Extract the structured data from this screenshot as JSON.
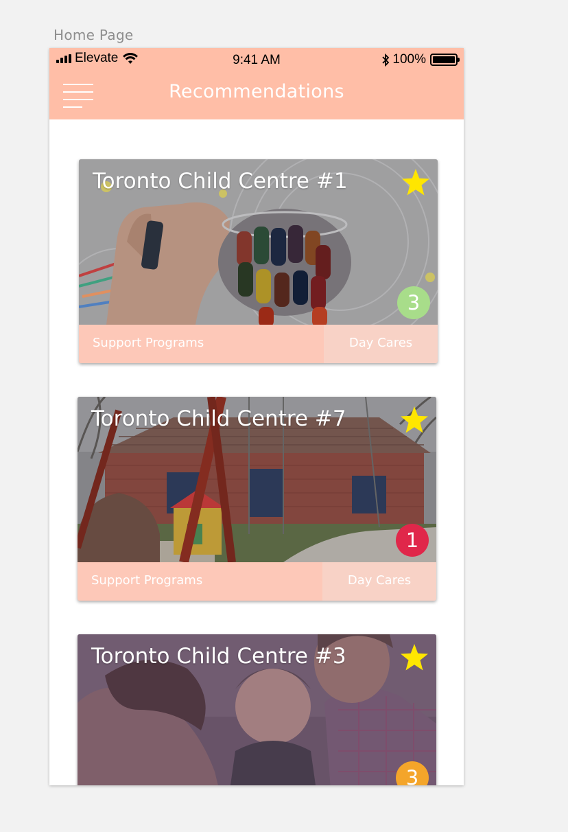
{
  "artboard_label": "Home Page",
  "status_bar": {
    "carrier": "Elevate",
    "time": "9:41 AM",
    "battery": "100%"
  },
  "nav": {
    "title": "Recommendations",
    "menu_icon": "hamburger-icon"
  },
  "colors": {
    "header": "#ffbea7",
    "tag_primary": "#fdc8b8",
    "tag_secondary": "#f8d2c6",
    "star": "#ffe600"
  },
  "cards": [
    {
      "title": "Toronto Child Centre #1",
      "icon": "star-icon",
      "badge": "3",
      "badge_color": "#a8dd8a",
      "tag_primary": "Support Programs",
      "tag_secondary": "Day Cares"
    },
    {
      "title": "Toronto Child Centre #7",
      "icon": "star-icon",
      "badge": "1",
      "badge_color": "#e0274a",
      "tag_primary": "Support Programs",
      "tag_secondary": "Day Cares"
    },
    {
      "title": "Toronto Child Centre #3",
      "icon": "star-icon",
      "badge": "3",
      "badge_color": "#f4a52a"
    }
  ]
}
